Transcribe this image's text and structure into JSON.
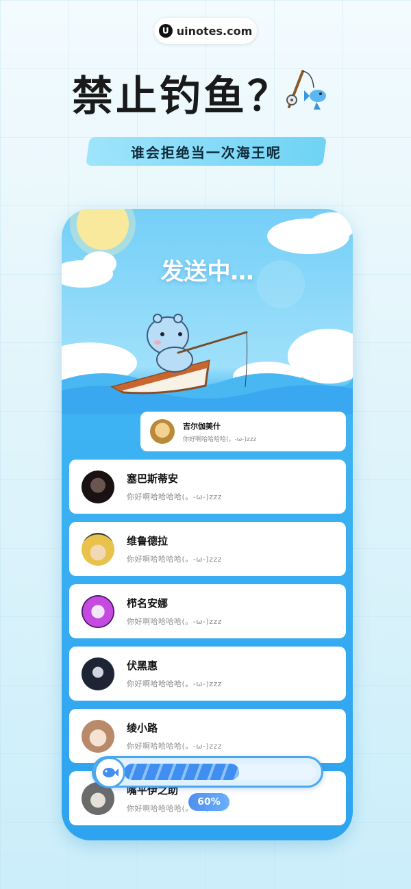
{
  "watermark": {
    "logo": "U",
    "text": "uinotes.com"
  },
  "hero": {
    "title": "禁止钓鱼？",
    "icon": "fishing-rod-fish-icon",
    "subtitle": "谁会拒绝当一次海王呢"
  },
  "scene": {
    "status_text": "发送中…"
  },
  "small_card": {
    "name": "吉尔伽美什",
    "message": "你好啊哈哈哈哈(。-ω-)zzz"
  },
  "contacts": [
    {
      "name": "塞巴斯蒂安",
      "message": "你好啊哈哈哈哈(。-ω-)zzz",
      "avatar_color": "#2a1d1d"
    },
    {
      "name": "维鲁德拉",
      "message": "你好啊哈哈哈哈(。-ω-)zzz",
      "avatar_color": "#e8c24a"
    },
    {
      "name": "栉名安娜",
      "message": "你好啊哈哈哈哈(。-ω-)zzz",
      "avatar_color": "#b23ad8"
    },
    {
      "name": "伏黑惠",
      "message": "你好啊哈哈哈哈(。-ω-)zzz",
      "avatar_color": "#1d2433"
    },
    {
      "name": "绫小路",
      "message": "你好啊哈哈哈哈(。-ω-)zzz",
      "avatar_color": "#b98a6a"
    },
    {
      "name": "嘴平伊之助",
      "message": "你好啊哈哈哈哈(。-ω-)zzz",
      "avatar_color": "#6b6b6b"
    }
  ],
  "progress": {
    "value": 0.6,
    "label": "60%",
    "icon": "fish-icon"
  },
  "colors": {
    "accent": "#2ea3ef",
    "banner": "#6fd3f5",
    "progress": "#3f8ef0"
  }
}
